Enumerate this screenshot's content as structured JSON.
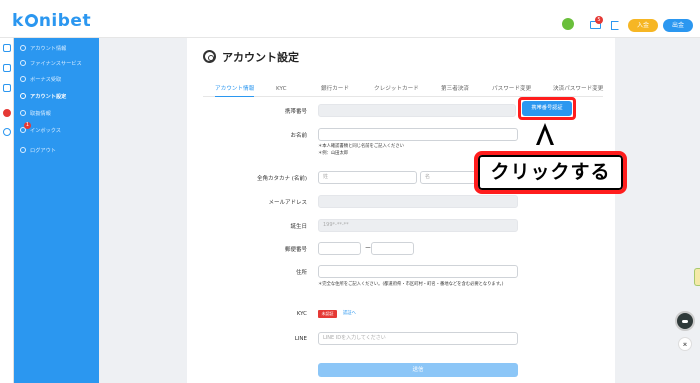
{
  "header": {
    "logo_parts": [
      "k",
      "ni",
      "bet"
    ],
    "mail_badge": "5",
    "deposit_label": "入金",
    "withdraw_label": "出金"
  },
  "sidebar": {
    "items": [
      {
        "label": "アカウント情報"
      },
      {
        "label": "ファイナンスサービス"
      },
      {
        "label": "ボーナス受取"
      },
      {
        "label": "アカウント設定",
        "active": true
      },
      {
        "label": "取扱情報"
      },
      {
        "label": "インボックス",
        "badge": "1"
      },
      {
        "label": "ログアウト"
      }
    ]
  },
  "page": {
    "title": "アカウント設定",
    "tabs": [
      "アカウント情報",
      "KYC",
      "銀行カード",
      "クレジットカード",
      "第三者決済",
      "パスワード変更",
      "決済パスワード変更"
    ]
  },
  "form": {
    "phone_label": "携帯番号",
    "verify_button": "携帯番号認証",
    "name_label": "お名前",
    "name_hints": [
      "＊本人確認書類と同じ名前をご記入ください",
      "＊例：山田太郎"
    ],
    "kana_label": "全角カタカナ (名前)",
    "kana_last_placeholder": "姓",
    "kana_first_placeholder": "名",
    "email_label": "メールアドレス",
    "birthday_label": "誕生日",
    "birthday_value": "199*-**-**",
    "postal_label": "郵便番号",
    "postal_dash": "ー",
    "address_label": "住所",
    "address_hint": "＊完全な住所をご記入ください。(都道府県・市区町村・町名・番地などを含む必要となります。)",
    "kyc_label": "KYC",
    "kyc_status": "未認証",
    "kyc_link": "認証へ",
    "line_label": "LINE",
    "line_placeholder": "LINE IDを入力してください",
    "submit_label": "送信"
  },
  "callout": {
    "text": "クリックする"
  },
  "floating": {
    "to_top": "⌅"
  },
  "colors": {
    "primary": "#2b97f0",
    "callout_border": "#ff1d1d",
    "deposit": "#f6b624",
    "badge": "#e53935"
  }
}
